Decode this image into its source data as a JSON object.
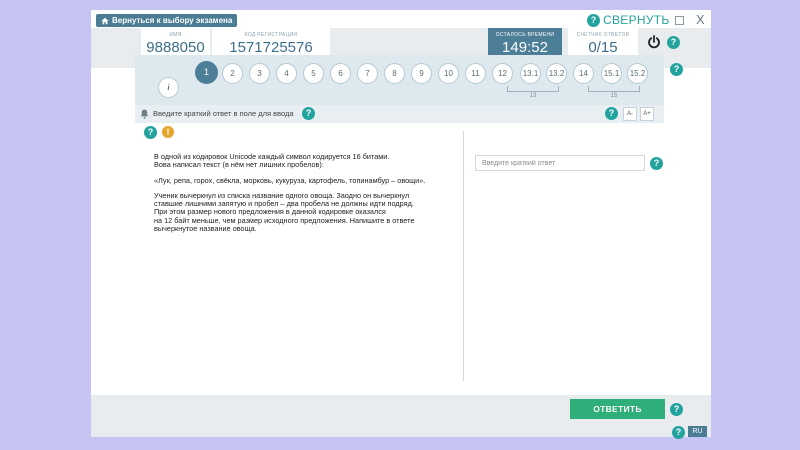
{
  "toolbar": {
    "back_label": "Вернуться к выбору экзамена",
    "collapse_label": "СВЕРНУТЬ",
    "close_label": "X",
    "help_label": "?"
  },
  "header": {
    "name_label": "ИМЯ",
    "name_value": "9888050",
    "reg_label": "КОД РЕГИСТРАЦИИ",
    "reg_value": "1571725576",
    "time_label": "ОСТАЛОСЬ ВРЕМЕНИ",
    "time_value": "149:52",
    "count_label": "СЧЕТЧИК ОТВЕТОВ",
    "count_value": "0/15"
  },
  "nav": {
    "info_label": "i",
    "tasks": [
      "1",
      "2",
      "3",
      "4",
      "5",
      "6",
      "7",
      "8",
      "9",
      "10",
      "11",
      "12",
      "13.1",
      "13.2",
      "14",
      "15.1",
      "15.2"
    ],
    "active_task": "1",
    "group13_label": "13",
    "group15_label": "15"
  },
  "hint": {
    "text": "Введите краткий ответ в поле для ввода",
    "font_minus": "A-",
    "font_plus": "A+"
  },
  "task": {
    "warn_label": "!",
    "p1_line1": "В одной из кодировок Unicode каждый символ кодируется 16 битами.",
    "p1_line2": "Вова написал текст (в нём нет лишних пробелов):",
    "p2": "«Лук, репа, горох, свёкла, морковь, кукуруза, картофель, топинамбур – овощи».",
    "p3_line1": "Ученик вычеркнул из списка название одного овоща. Заодно он вычеркнул",
    "p3_line2": "ставшие лишними запятую и пробел – два пробела не должны идти подряд.",
    "p3_line3": "При этом размер нового предложения в данной кодировке оказался",
    "p3_line4": "на 12 байт меньше, чем размер исходного предложения. Напишите в ответе",
    "p3_line5": "вычеркнутое название овоща."
  },
  "answer": {
    "placeholder": "Введите краткий ответ",
    "value": ""
  },
  "footer": {
    "submit_label": "ОТВЕТИТЬ",
    "lang_label": "RU"
  },
  "colors": {
    "accent": "#23a39d",
    "header_active": "#4d7e98",
    "submit": "#2eae78",
    "warning": "#e3a52c",
    "background": "#c6c4f2"
  }
}
